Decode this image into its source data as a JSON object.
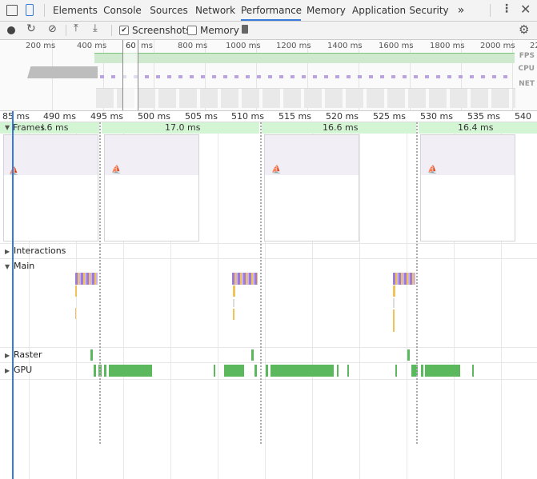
{
  "tabs": [
    "Elements",
    "Console",
    "Sources",
    "Network",
    "Performance",
    "Memory",
    "Application",
    "Security"
  ],
  "active_tab": "Performance",
  "more_tabs_icon": "»",
  "toolbar": {
    "screenshots_label": "Screenshots",
    "memory_label": "Memory",
    "screenshots_checked": true,
    "memory_checked": false
  },
  "overview": {
    "ticks": [
      "200 ms",
      "400 ms",
      "800 ms",
      "1000 ms",
      "1200 ms",
      "1400 ms",
      "1600 ms",
      "1800 ms",
      "2000 ms",
      "22"
    ],
    "selection_label": "60",
    "selection_unit": "ms",
    "lanes": [
      "FPS",
      "CPU",
      "NET"
    ]
  },
  "ruler": {
    "ticks": [
      "85 ms",
      "490 ms",
      "495 ms",
      "500 ms",
      "505 ms",
      "510 ms",
      "515 ms",
      "520 ms",
      "525 ms",
      "530 ms",
      "535 ms",
      "540"
    ]
  },
  "frames": {
    "label": "Frames",
    "durations": [
      "i.6 ms",
      "17.0 ms",
      "16.6 ms",
      "16.4 ms"
    ]
  },
  "sections": {
    "interactions": "Interactions",
    "main": "Main",
    "raster": "Raster",
    "gpu": "GPU"
  },
  "colors": {
    "accent": "#3879d9",
    "frame_green": "#d4f5d4",
    "gpu_green": "#5cb85c",
    "scripting": "#9e7bd8",
    "loading": "#f0c25a"
  }
}
